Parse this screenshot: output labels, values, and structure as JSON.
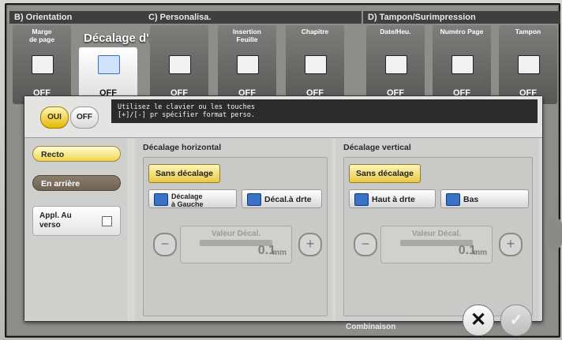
{
  "sections": {
    "orientation": "B) Orientation",
    "personalisa": "C) Personalisa.",
    "tampon": "D) Tampon/Surimpression"
  },
  "tiles": [
    {
      "label": "Marge\nde page",
      "value": "OFF",
      "icon": "page-margin-icon"
    },
    {
      "label": "",
      "value": "OFF",
      "icon": "image-shift-icon"
    },
    {
      "label": "",
      "value": "OFF",
      "icon": "cover-icon"
    },
    {
      "label": "Insertion\nFeuille",
      "value": "OFF",
      "icon": "insert-sheet-icon"
    },
    {
      "label": "Chapitre",
      "value": "OFF",
      "icon": "chapter-icon"
    },
    {
      "label": "Date/Heu.",
      "value": "OFF",
      "icon": "date-stamp-icon"
    },
    {
      "label": "Numéro Page",
      "value": "OFF",
      "icon": "page-number-icon"
    },
    {
      "label": "Tampon",
      "value": "OFF",
      "icon": "stamp-icon"
    }
  ],
  "active_tile_title": "Décalage d'image",
  "dialog": {
    "toggle_on": "OUI",
    "toggle_off": "OFF",
    "instruction": "Utilisez le clavier ou les touches\n[+]/[-] pr spécifier format perso.",
    "left": {
      "recto": "Recto",
      "en_arriere": "En arrière",
      "appl_au_verso": "Appl. Au\nverso"
    },
    "horizontal": {
      "title": "Décalage horizontal",
      "sans": "Sans décalage",
      "gauche": "Décalage\nà Gauche",
      "droite": "Décal.à drte",
      "value_label": "Valeur Décal.",
      "value": "0.1",
      "unit": "mm"
    },
    "vertical": {
      "title": "Décalage vertical",
      "sans": "Sans décalage",
      "haut": "Haut à drte",
      "bas": "Bas",
      "value_label": "Valeur Décal.",
      "value": "0.1",
      "unit": "mm"
    }
  },
  "bottom": {
    "combinaison": "Combinaison"
  },
  "colors": {
    "accent_yellow": "#f1d64f",
    "dialog_bg": "#d8d8d6",
    "panel_dark": "#2b2b2b"
  }
}
